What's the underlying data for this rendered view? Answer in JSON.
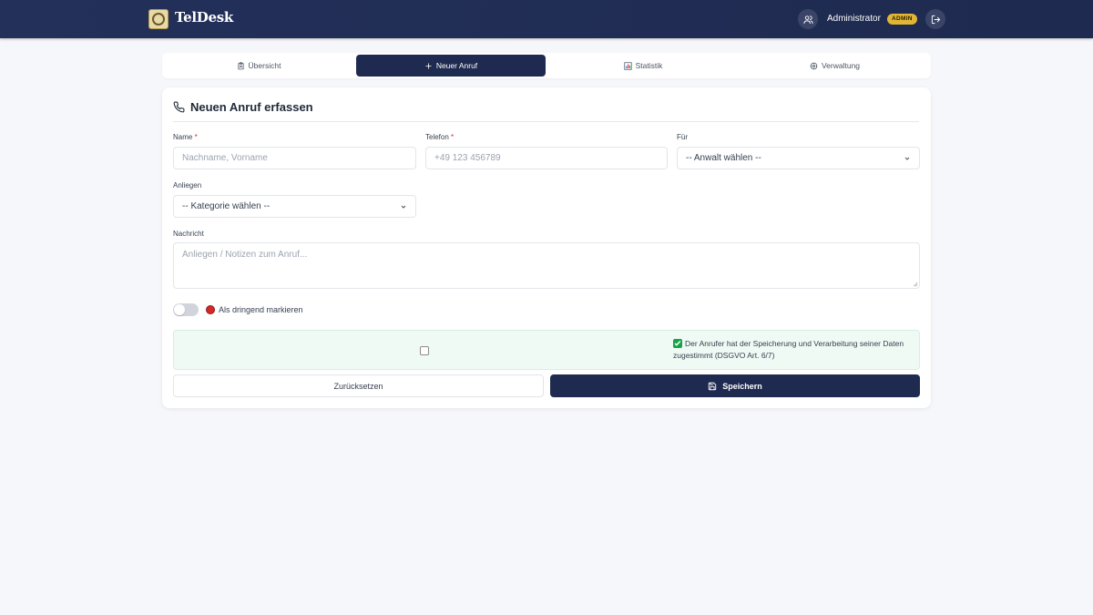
{
  "app": {
    "brand": "TelDesk"
  },
  "user": {
    "name": "Administrator",
    "role_badge": "ADMIN"
  },
  "tabs": [
    {
      "label": "Übersicht",
      "icon": "clipboard-icon",
      "active": false
    },
    {
      "label": "Neuer Anruf",
      "icon": "plus-icon",
      "active": true
    },
    {
      "label": "Statistik",
      "icon": "bar-chart-icon",
      "active": false
    },
    {
      "label": "Verwaltung",
      "icon": "gear-icon",
      "active": false
    }
  ],
  "form": {
    "title": "Neuen Anruf erfassen",
    "name": {
      "label": "Name",
      "required_mark": "*",
      "placeholder": "Nachname, Vorname",
      "value": ""
    },
    "phone": {
      "label": "Telefon",
      "required_mark": "*",
      "placeholder": "+49 123 456789",
      "value": ""
    },
    "for": {
      "label": "Für",
      "selected": "-- Anwalt wählen --"
    },
    "concern": {
      "label": "Anliegen",
      "selected": "-- Kategorie wählen --"
    },
    "message": {
      "label": "Nachricht",
      "placeholder": "Anliegen / Notizen zum Anruf...",
      "value": ""
    },
    "urgent": {
      "label": "Als dringend markieren",
      "checked": false
    },
    "consent": {
      "text": "Der Anrufer hat der Speicherung und Verarbeitung seiner Daten zugestimmt (DSGVO Art. 6/7)",
      "checked": false
    },
    "reset_label": "Zurücksetzen",
    "save_label": "Speichern"
  },
  "colors": {
    "primary": "#1e2a4f",
    "accent_badge": "#e2b534",
    "urgent": "#dc2626",
    "consent_bg": "#effaf4"
  }
}
